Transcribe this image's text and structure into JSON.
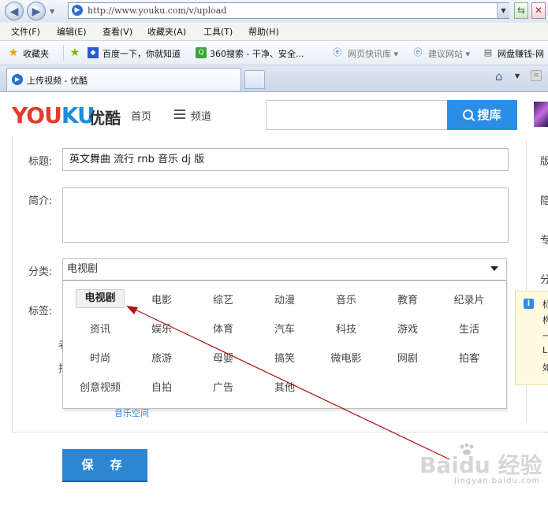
{
  "browser": {
    "address": "http://www.youku.com/v/upload",
    "menu": [
      "文件(F)",
      "编辑(E)",
      "查看(V)",
      "收藏夹(A)",
      "工具(T)",
      "帮助(H)"
    ],
    "favorites_label": "收藏夹",
    "favorites": [
      {
        "label": "百度一下，你就知道",
        "icon": "baidu-paw-icon"
      },
      {
        "label": "360搜索 - 干净、安全...",
        "icon": "360-search-icon"
      },
      {
        "label": "网页快讯库 ▾",
        "icon": "web-slice-icon"
      },
      {
        "label": "建议网站 ▾",
        "icon": "suggested-sites-icon"
      },
      {
        "label": "网盘赚钱-网",
        "icon": "page-icon"
      }
    ],
    "tab_title": "上传视频 - 优酷"
  },
  "header": {
    "logo_en_1": "YOU",
    "logo_en_2": "KU",
    "logo_cn": "优酷",
    "nav_home": "首页",
    "nav_channel": "频道",
    "search_button": "搜库",
    "colors": {
      "logo_red": "#e53b2c",
      "logo_blue": "#1d8ce0",
      "accent": "#2b8ee6"
    }
  },
  "form": {
    "title_label": "标题:",
    "title_value": "英文舞曲 流行 rnb 音乐 dj 版",
    "desc_label": "简介:",
    "category_label": "分类:",
    "category_value": "电视剧",
    "tags_label": "标签:",
    "categories": [
      [
        "电视剧",
        "电影",
        "综艺",
        "动漫",
        "音乐",
        "教育",
        "纪录片"
      ],
      [
        "资讯",
        "娱乐",
        "体育",
        "汽车",
        "科技",
        "游戏",
        "生活"
      ],
      [
        "时尚",
        "旅游",
        "母婴",
        "搞笑",
        "微电影",
        "网剧",
        "拍客"
      ],
      [
        "创意视频",
        "自拍",
        "广告",
        "其他"
      ]
    ],
    "selected_category": "电视剧",
    "hidden_partial_1": "老",
    "hidden_partial_2": "排",
    "music_space_link": "音乐空间",
    "save_button": "保 存"
  },
  "side": {
    "labels": [
      "版",
      "隐",
      "专",
      "分"
    ],
    "tip_lines": [
      "标",
      "构",
      "一",
      "L",
      "如"
    ]
  },
  "watermark": {
    "text": "Baidu 经验",
    "sub": "jingyan.baidu.com"
  }
}
